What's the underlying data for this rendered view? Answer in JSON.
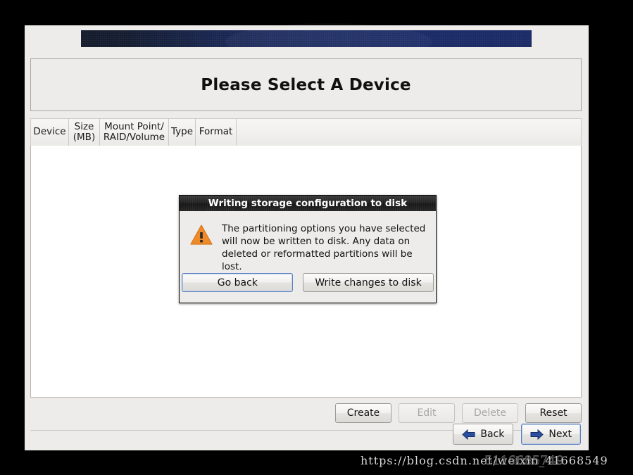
{
  "window": {
    "title": "Please Select A Device"
  },
  "table": {
    "columns": [
      {
        "id": "device",
        "label": "Device"
      },
      {
        "id": "size",
        "label": "Size\n(MB)"
      },
      {
        "id": "mount",
        "label": "Mount Point/\nRAID/Volume"
      },
      {
        "id": "type",
        "label": "Type"
      },
      {
        "id": "format",
        "label": "Format"
      }
    ],
    "rows": []
  },
  "actions": {
    "create": {
      "label": "Create",
      "enabled": true
    },
    "edit": {
      "label": "Edit",
      "enabled": false
    },
    "delete": {
      "label": "Delete",
      "enabled": false
    },
    "reset": {
      "label": "Reset",
      "enabled": true
    }
  },
  "navigation": {
    "back": {
      "label": "Back",
      "icon": "arrow-left-icon"
    },
    "next": {
      "label": "Next",
      "icon": "arrow-right-icon",
      "focused": true
    }
  },
  "dialog": {
    "title": "Writing storage configuration to disk",
    "icon": "warning-triangle-icon",
    "message": "The partitioning options you have selected\nwill now be written to disk.  Any data on\ndeleted or reformatted partitions will be lost.",
    "buttons": {
      "go_back": {
        "label": "Go back",
        "focused": true
      },
      "write_changes": {
        "label": "Write changes to disk",
        "focused": false
      }
    }
  },
  "watermark": {
    "url": "https://blog.csdn.net/weixin_41668549",
    "overlay": "5116685749"
  },
  "colors": {
    "banner_dark": "#131a2b",
    "banner_blue": "#1a2a66",
    "window_bg": "#edecea",
    "list_bg": "#ffffff",
    "warning_orange": "#f08a28",
    "focus_blue": "#5a7fbe",
    "titlebar_dark": "#1d1d1d"
  }
}
